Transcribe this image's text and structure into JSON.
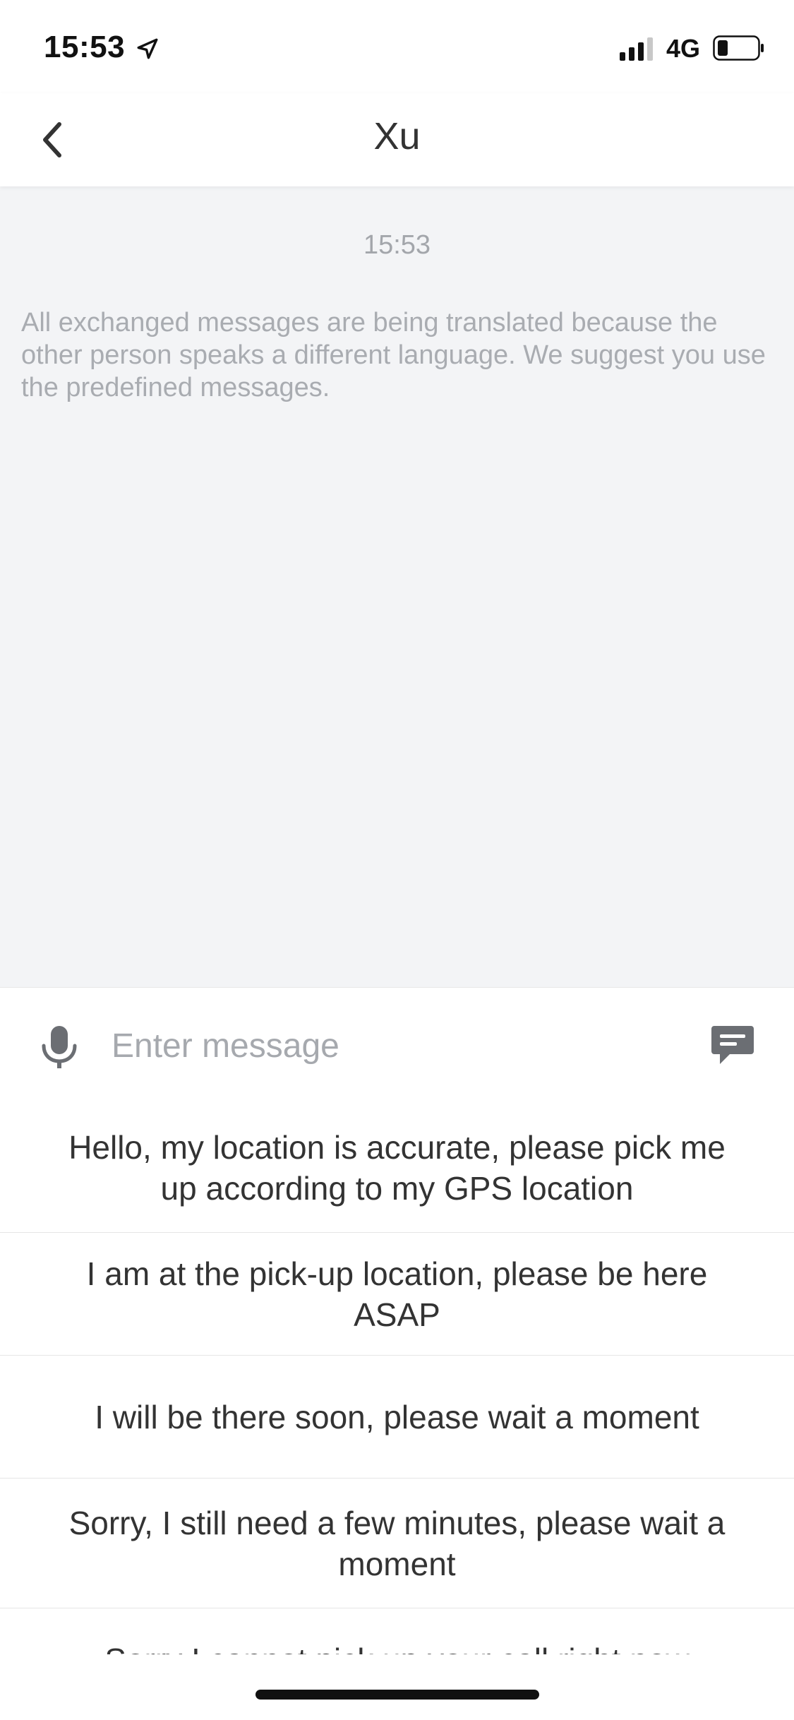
{
  "status_bar": {
    "time": "15:53",
    "network": "4G",
    "icons": [
      "location-arrow-icon",
      "signal-icon",
      "battery-icon"
    ]
  },
  "nav": {
    "title": "Xu",
    "back_icon": "chevron-left-icon"
  },
  "chat": {
    "timestamp": "15:53",
    "system_notice": "All exchanged messages are being translated because the other person speaks a different language. We suggest you use the predefined messages."
  },
  "input": {
    "placeholder": "Enter message",
    "value": "",
    "mic_icon": "microphone-icon",
    "quick_reply_icon": "message-bubble-icon"
  },
  "quick_replies": [
    "Hello, my location is accurate, please pick me up according to my GPS location",
    "I am at the pick-up location, please be here ASAP",
    "I will be there soon, please wait a moment",
    "Sorry, I still need a few minutes, please wait a moment",
    "Sorry I cannot pick up your call right now"
  ],
  "colors": {
    "chat_background": "#f3f4f6",
    "icon_gray": "#6b6e73",
    "muted_text": "#a9acb1",
    "primary_text": "#333333"
  }
}
